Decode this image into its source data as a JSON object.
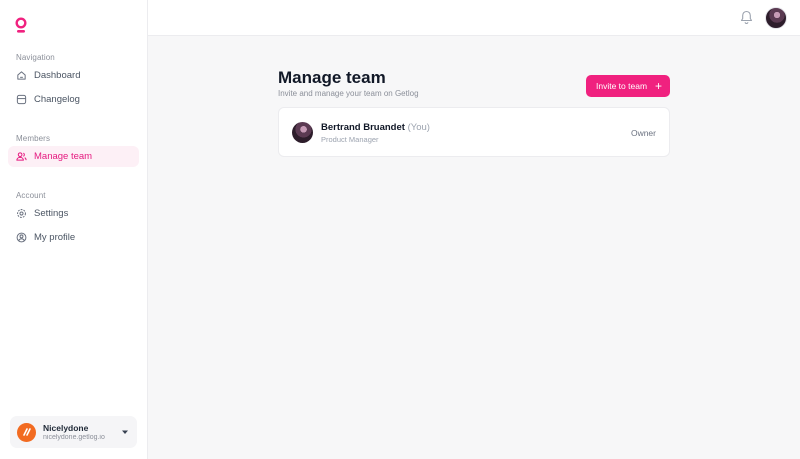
{
  "brand": {
    "accent": "#f0217f",
    "icon": "getlog-logo"
  },
  "sidebar": {
    "sections": [
      {
        "label": "Navigation",
        "items": [
          {
            "label": "Dashboard",
            "icon": "home-icon"
          },
          {
            "label": "Changelog",
            "icon": "changelog-icon"
          }
        ]
      },
      {
        "label": "Members",
        "items": [
          {
            "label": "Manage team",
            "icon": "users-icon",
            "active": true
          }
        ]
      },
      {
        "label": "Account",
        "items": [
          {
            "label": "Settings",
            "icon": "gear-icon"
          },
          {
            "label": "My profile",
            "icon": "user-circle-icon"
          }
        ]
      }
    ],
    "workspace": {
      "name": "Nicelydone",
      "domain": "nicelydone.getlog.io",
      "logo_color": "#f26b21"
    }
  },
  "topbar": {
    "icons": [
      "bell-icon",
      "avatar"
    ]
  },
  "main": {
    "title": "Manage team",
    "subtitle": "Invite and manage your team on Getlog",
    "invite_label": "Invite to team",
    "members": [
      {
        "name": "Bertrand Bruandet",
        "you": "(You)",
        "role": "Product Manager",
        "permission": "Owner"
      }
    ]
  }
}
